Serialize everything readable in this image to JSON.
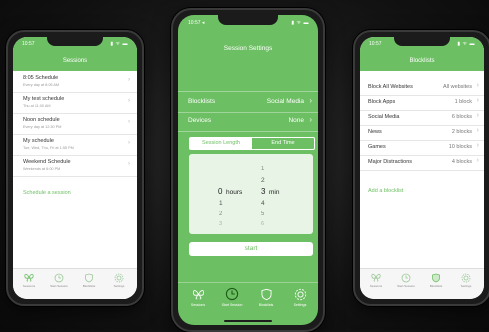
{
  "phone_left": {
    "status": {
      "time": "10:57",
      "icons": "▮ ᯤ ▬"
    },
    "title": "Sessions",
    "sessions": [
      {
        "name": "8:05 Schedule",
        "detail": "Every day at 8:05 AM"
      },
      {
        "name": "My test schedule",
        "detail": "Thu at 11:00 AM"
      },
      {
        "name": "Noon schedule",
        "detail": "Every day at 12:30 PM"
      },
      {
        "name": "My schedule",
        "detail": "Tue, Wed, Thu, Fri at 1:55 PM"
      },
      {
        "name": "Weekend Schedule",
        "detail": "Weekends at 6:00 PM"
      }
    ],
    "schedule_link": "Schedule a session",
    "tabs": [
      {
        "icon": "butterfly-icon",
        "label": "Sessions"
      },
      {
        "icon": "clock-icon",
        "label": "Start Session"
      },
      {
        "icon": "shield-icon",
        "label": "Blocklists"
      },
      {
        "icon": "gear-icon",
        "label": "Settings"
      }
    ]
  },
  "phone_center": {
    "status": {
      "time": "10:57 ◂",
      "icons": "▮ ᯤ ▬"
    },
    "title": "Session Settings",
    "rows": [
      {
        "label": "Blocklists",
        "value": "Social Media"
      },
      {
        "label": "Devices",
        "value": "None"
      }
    ],
    "segments": [
      "Session Length",
      "End Time"
    ],
    "picker": {
      "hours_above": [
        "1",
        "2"
      ],
      "hours_col_above": [],
      "selected_hours": "0",
      "hours_unit": "hours",
      "selected_min": "3",
      "min_unit": "min",
      "min_above": [
        "1",
        "2"
      ],
      "hours_below": [
        "1",
        "2",
        "3"
      ],
      "min_below": [
        "4",
        "5",
        "6"
      ]
    },
    "start_label": "start",
    "tabs": [
      {
        "icon": "butterfly-icon",
        "label": "Sessions"
      },
      {
        "icon": "clock-icon",
        "label": "Start Session"
      },
      {
        "icon": "shield-icon",
        "label": "Blocklists"
      },
      {
        "icon": "gear-icon",
        "label": "Settings"
      }
    ]
  },
  "phone_right": {
    "status": {
      "time": "10:57",
      "icons": "▮ ᯤ ▬"
    },
    "title": "Blocklists",
    "lists": [
      {
        "name": "Block All Websites",
        "count": "All websites"
      },
      {
        "name": "Block Apps",
        "count": "1 block"
      },
      {
        "name": "Social Media",
        "count": "6 blocks"
      },
      {
        "name": "News",
        "count": "2 blocks"
      },
      {
        "name": "Games",
        "count": "10 blocks"
      },
      {
        "name": "Major Distractions",
        "count": "4 blocks"
      }
    ],
    "add_link": "Add a blocklist",
    "tabs": [
      {
        "icon": "butterfly-icon",
        "label": "Sessions"
      },
      {
        "icon": "clock-icon",
        "label": "Start Session"
      },
      {
        "icon": "shield-icon",
        "label": "Blocklists"
      },
      {
        "icon": "gear-icon",
        "label": "Settings"
      }
    ]
  }
}
